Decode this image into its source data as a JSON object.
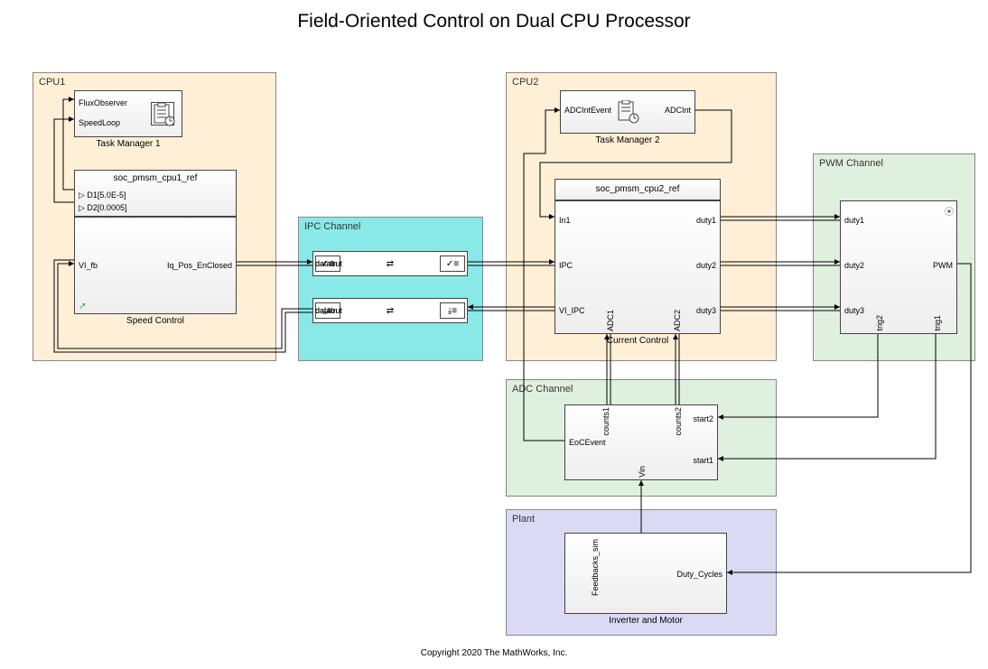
{
  "title": "Field-Oriented Control on Dual CPU Processor",
  "copyright": "Copyright 2020 The MathWorks, Inc.",
  "groups": {
    "cpu1": {
      "title": "CPU1",
      "bg": "#FFEFD6"
    },
    "ipc": {
      "title": "IPC Channel",
      "bg": "#89E8E8"
    },
    "cpu2": {
      "title": "CPU2",
      "bg": "#FFEFD6"
    },
    "pwm": {
      "title": "PWM Channel",
      "bg": "#E0F0DF"
    },
    "adc": {
      "title": "ADC Channel",
      "bg": "#E0F0DF"
    },
    "plant": {
      "title": "Plant",
      "bg": "#DADAF5"
    }
  },
  "blocks": {
    "tm1": {
      "title": "Task Manager 1",
      "ports": {
        "flux": "FluxObserver",
        "speed": "SpeedLoop"
      }
    },
    "speed": {
      "ref": "soc_pmsm_cpu1_ref",
      "d1": "D1[5.0E-5]",
      "d2": "D2[0.0005]",
      "in_vi": "VI_fb",
      "out_iq": "Iq_Pos_EnClosed",
      "label": "Speed Control"
    },
    "ipc_top": {
      "left": "datain",
      "right": "dataout"
    },
    "ipc_bot": {
      "left": "dataout",
      "right": "datain"
    },
    "tm2": {
      "title": "Task Manager 2",
      "portin": "ADCIntEvent",
      "portout": "ADCInt"
    },
    "curr": {
      "ref": "soc_pmsm_cpu2_ref",
      "in1": "In1",
      "ipc": "IPC",
      "vi": "VI_IPC",
      "adc1": "ADC1",
      "adc2": "ADC2",
      "d1": "duty1",
      "d2": "duty2",
      "d3": "duty3",
      "label": "Current Control"
    },
    "pwm": {
      "d1": "duty1",
      "d2": "duty2",
      "d3": "duty3",
      "pwm": "PWM",
      "trig1": "trig1",
      "trig2": "trig2"
    },
    "adc": {
      "eoc": "EoCEvent",
      "c1": "counts1",
      "c2": "counts2",
      "s1": "start1",
      "s2": "start2",
      "vin": "Vin"
    },
    "plant": {
      "fb": "Feedbacks_sim",
      "duty": "Duty_Cycles",
      "label": "Inverter and Motor"
    }
  },
  "chart_data": {
    "type": "block-diagram",
    "groups": [
      {
        "id": "CPU1",
        "color": "#FFEFD6",
        "blocks": [
          "TaskManager1",
          "SpeedControl"
        ]
      },
      {
        "id": "IPC Channel",
        "color": "#89E8E8",
        "blocks": [
          "IPC_fwd",
          "IPC_rev"
        ]
      },
      {
        "id": "CPU2",
        "color": "#FFEFD6",
        "blocks": [
          "TaskManager2",
          "CurrentControl"
        ]
      },
      {
        "id": "PWM Channel",
        "color": "#E0F0DF",
        "blocks": [
          "PWM"
        ]
      },
      {
        "id": "ADC Channel",
        "color": "#E0F0DF",
        "blocks": [
          "ADC"
        ]
      },
      {
        "id": "Plant",
        "color": "#DADAF5",
        "blocks": [
          "InverterAndMotor"
        ]
      }
    ],
    "blocks": {
      "TaskManager1": {
        "in": [
          "FluxObserver",
          "SpeedLoop"
        ],
        "label": "Task Manager 1"
      },
      "SpeedControl": {
        "ref": "soc_pmsm_cpu1_ref",
        "params": [
          "D1[5.0E-5]",
          "D2[0.0005]"
        ],
        "in": [
          "VI_fb"
        ],
        "out": [
          "Iq_Pos_EnClosed"
        ],
        "label": "Speed Control"
      },
      "IPC_fwd": {
        "in": [
          "datain"
        ],
        "out": [
          "dataout"
        ]
      },
      "IPC_rev": {
        "in": [
          "datain"
        ],
        "out": [
          "dataout"
        ]
      },
      "TaskManager2": {
        "in": [
          "ADCIntEvent"
        ],
        "out": [
          "ADCInt"
        ],
        "label": "Task Manager 2"
      },
      "CurrentControl": {
        "ref": "soc_pmsm_cpu2_ref",
        "in": [
          "In1",
          "IPC",
          "VI_IPC",
          "ADC1",
          "ADC2"
        ],
        "out": [
          "duty1",
          "duty2",
          "duty3"
        ],
        "label": "Current Control"
      },
      "PWM": {
        "in": [
          "duty1",
          "duty2",
          "duty3"
        ],
        "out": [
          "PWM",
          "trig1",
          "trig2"
        ]
      },
      "ADC": {
        "in": [
          "start1",
          "start2",
          "Vin"
        ],
        "out": [
          "EoCEvent",
          "counts1",
          "counts2"
        ]
      },
      "InverterAndMotor": {
        "in": [
          "Duty_Cycles"
        ],
        "out": [
          "Feedbacks_sim"
        ],
        "label": "Inverter and Motor"
      }
    },
    "edges": [
      [
        "SpeedControl.Iq_Pos_EnClosed",
        "IPC_fwd.datain"
      ],
      [
        "IPC_fwd.dataout",
        "CurrentControl.IPC"
      ],
      [
        "CurrentControl.VI_IPC",
        "IPC_rev.datain"
      ],
      [
        "IPC_rev.dataout",
        "SpeedControl.VI_fb"
      ],
      [
        "TaskManager2.ADCInt",
        "CurrentControl.In1"
      ],
      [
        "CurrentControl.duty1",
        "PWM.duty1"
      ],
      [
        "CurrentControl.duty2",
        "PWM.duty2"
      ],
      [
        "CurrentControl.duty3",
        "PWM.duty3"
      ],
      [
        "PWM.trig1",
        "ADC.start1"
      ],
      [
        "PWM.trig2",
        "ADC.start2"
      ],
      [
        "ADC.counts1",
        "CurrentControl.ADC1"
      ],
      [
        "ADC.counts2",
        "CurrentControl.ADC2"
      ],
      [
        "ADC.EoCEvent",
        "TaskManager2.ADCIntEvent"
      ],
      [
        "ADC.Vin",
        "InverterAndMotor.Feedbacks_sim"
      ],
      [
        "PWM.PWM",
        "InverterAndMotor.Duty_Cycles"
      ],
      [
        "SpeedControl.D1",
        "TaskManager1.FluxObserver"
      ],
      [
        "SpeedControl.D2",
        "TaskManager1.SpeedLoop"
      ]
    ]
  }
}
